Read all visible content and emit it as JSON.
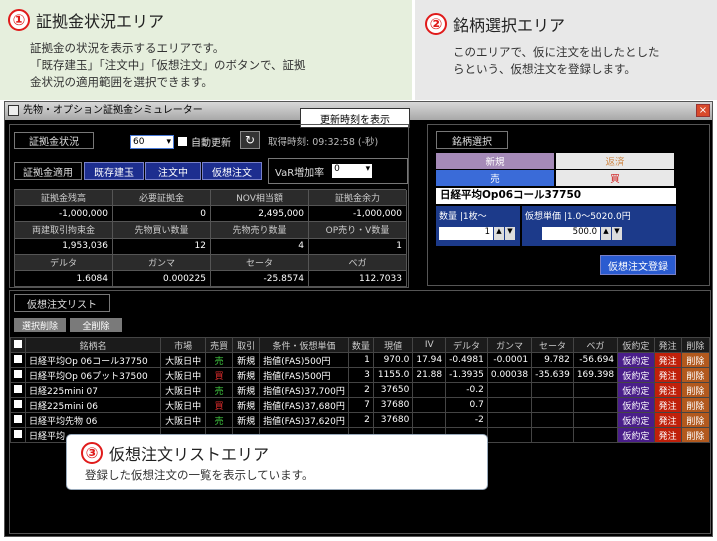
{
  "panel1": {
    "num": "①",
    "title": "証拠金状況エリア",
    "desc1": "証拠金の状況を表示するエリアです。",
    "desc2": "「既存建玉」「注文中」「仮想注文」のボタンで、証拠",
    "desc3": "金状況の適用範囲を選択できます。"
  },
  "panel2": {
    "num": "②",
    "title": "銘柄選択エリア",
    "desc1": "このエリアで、仮に注文を出したとした",
    "desc2": "らという、仮想注文を登録します。"
  },
  "panel3": {
    "num": "③",
    "title": "仮想注文リストエリア",
    "desc": "登録した仮想注文の一覧を表示しています。"
  },
  "window": {
    "title": "先物・オプション証拠金シミュレーター",
    "close": "×",
    "update_note": "更新時刻を表示"
  },
  "margin": {
    "label": "証拠金状況",
    "select": "60",
    "auto": "自動更新",
    "refresh": "↻",
    "time": "取得時刻: 09:32:58 (-秒)",
    "apply": "証拠金適用",
    "b1": "既存建玉",
    "b2": "注文中",
    "b3": "仮想注文",
    "var_label": "VaR増加率",
    "var_val": "0",
    "rows": [
      [
        "証拠金残高",
        "必要証拠金",
        "NOV相当額",
        "証拠金余力"
      ],
      [
        "-1,000,000",
        "0",
        "2,495,000",
        "-1,000,000"
      ],
      [
        "両建取引拘束金",
        "先物買い数量",
        "先物売り数量",
        "OP売り・V数量"
      ],
      [
        "1,953,036",
        "12",
        "4",
        "1"
      ],
      [
        "デルタ",
        "ガンマ",
        "セータ",
        "ベガ"
      ],
      [
        "1.6084",
        "0.000225",
        "-25.8574",
        "112.7033"
      ]
    ]
  },
  "select": {
    "title": "銘柄選択",
    "new": "新規",
    "settle": "返済",
    "sell": "売",
    "buy": "買",
    "symbol": "日経平均Op06コール37750",
    "qty_label": "数量 |1枚～",
    "price_label": "仮想単価 |1.0～5020.0円",
    "qty": "1",
    "price": "500.0",
    "register": "仮想注文登録"
  },
  "list": {
    "title": "仮想注文リスト",
    "sel_del": "選択削除",
    "all_del": "全削除",
    "headers": [
      "銘柄名",
      "市場",
      "売買",
      "取引",
      "条件・仮想単価",
      "数量",
      "現値",
      "IV",
      "デルタ",
      "ガンマ",
      "セータ",
      "ベガ",
      "仮約定",
      "発注",
      "削除"
    ],
    "rows": [
      [
        "日経平均Op 06コール37750",
        "大阪日中",
        "売",
        "新規",
        "指値(FAS)500円",
        "1",
        "970.0",
        "17.94",
        "-0.4981",
        "-0.0001",
        "9.782",
        "-56.694",
        "仮約定",
        "発注",
        "削除"
      ],
      [
        "日経平均Op 06プット37500",
        "大阪日中",
        "買",
        "新規",
        "指値(FAS)500円",
        "3",
        "1155.0",
        "21.88",
        "-1.3935",
        "0.00038",
        "-35.639",
        "169.398",
        "仮約定",
        "発注",
        "削除"
      ],
      [
        "日経225mini 07",
        "大阪日中",
        "売",
        "新規",
        "指値(FAS)37,700円",
        "2",
        "37650",
        "",
        "-0.2",
        "",
        "",
        "",
        "仮約定",
        "発注",
        "削除"
      ],
      [
        "日経225mini 06",
        "大阪日中",
        "買",
        "新規",
        "指値(FAS)37,680円",
        "7",
        "37680",
        "",
        "0.7",
        "",
        "",
        "",
        "仮約定",
        "発注",
        "削除"
      ],
      [
        "日経平均先物 06",
        "大阪日中",
        "売",
        "新規",
        "指値(FAS)37,620円",
        "2",
        "37680",
        "",
        "-2",
        "",
        "",
        "",
        "仮約定",
        "発注",
        "削除"
      ],
      [
        "日経平均",
        "",
        "",
        "",
        "",
        "",
        "",
        "",
        "",
        "",
        "",
        "",
        "仮約定",
        "発注",
        "削除"
      ]
    ]
  }
}
